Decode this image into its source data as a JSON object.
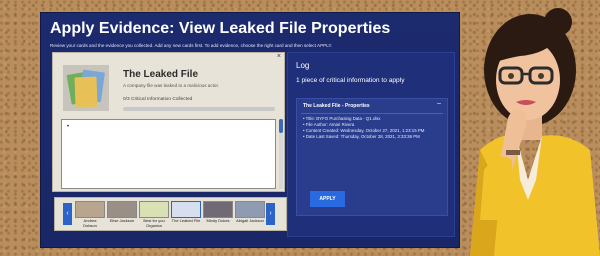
{
  "header": {
    "title": "Apply Evidence: View Leaked File Properties",
    "subtitle": "Review your cards and the evidence you collected. Add any new cards first. To add evidence, choose the right card and then select APPLY."
  },
  "card": {
    "close_label": "×",
    "name": "The Leaked File",
    "description": "A company file was leaked to a malicious actor.",
    "critical_label": "0/3 Critical Information Collected",
    "progress_fraction": 0,
    "notes_bullet": "•"
  },
  "carousel": {
    "prev_label": "‹",
    "next_label": "›",
    "items": [
      {
        "label_line1": "Andrea",
        "label_line2": "Dobson"
      },
      {
        "label_line1": "Elise Jackson",
        "label_line2": ""
      },
      {
        "label_line1": "Best for you",
        "label_line2": "Organics"
      },
      {
        "label_line1": "The Leaked File",
        "label_line2": ""
      },
      {
        "label_line1": "Mindy Dukes",
        "label_line2": ""
      },
      {
        "label_line1": "Abigail Jackson",
        "label_line2": ""
      }
    ],
    "selected_index": 3
  },
  "log": {
    "title": "Log",
    "info": "1 piece of critical information to apply",
    "properties": {
      "heading": "The Leaked File - Properties",
      "collapse_label": "–",
      "items": [
        "• Title: BYFO Purchasing Data - Q1.xlsx",
        "• File Author: Amari Rivera",
        "• Content Created: Wednesday, October 27, 2021, 1:23:15 PM",
        "• Date Last Saved: Thursday, October 28, 2021, 3:33:36 PM"
      ],
      "apply_label": "APPLY"
    }
  },
  "colors": {
    "panel_bg": "#1c2a6e",
    "accent_blue": "#2a6ae0",
    "card_bg": "#e7e3d9",
    "cork": "#b98d5c"
  }
}
